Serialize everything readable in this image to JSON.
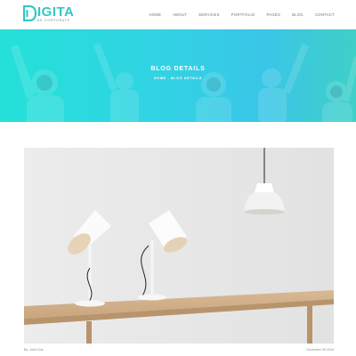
{
  "brand": {
    "name": "IGITA",
    "tagline": "BE CORPORATE",
    "accent_color": "#2fc8c8"
  },
  "nav": {
    "items": [
      "HOME",
      "ABOUT",
      "SERVICES",
      "PORTFOLIO",
      "PAGES",
      "BLOG",
      "CONTACT"
    ]
  },
  "hero": {
    "title": "BLOG DETAILS",
    "breadcrumb": "HOME - BLOG DETAILS",
    "gradient_start": "#24e0d8",
    "gradient_end": "#3ac6e7"
  },
  "post": {
    "image_alt": "lamps-on-table-photo",
    "author": "By: John Doe",
    "date": "December 28 2016"
  }
}
